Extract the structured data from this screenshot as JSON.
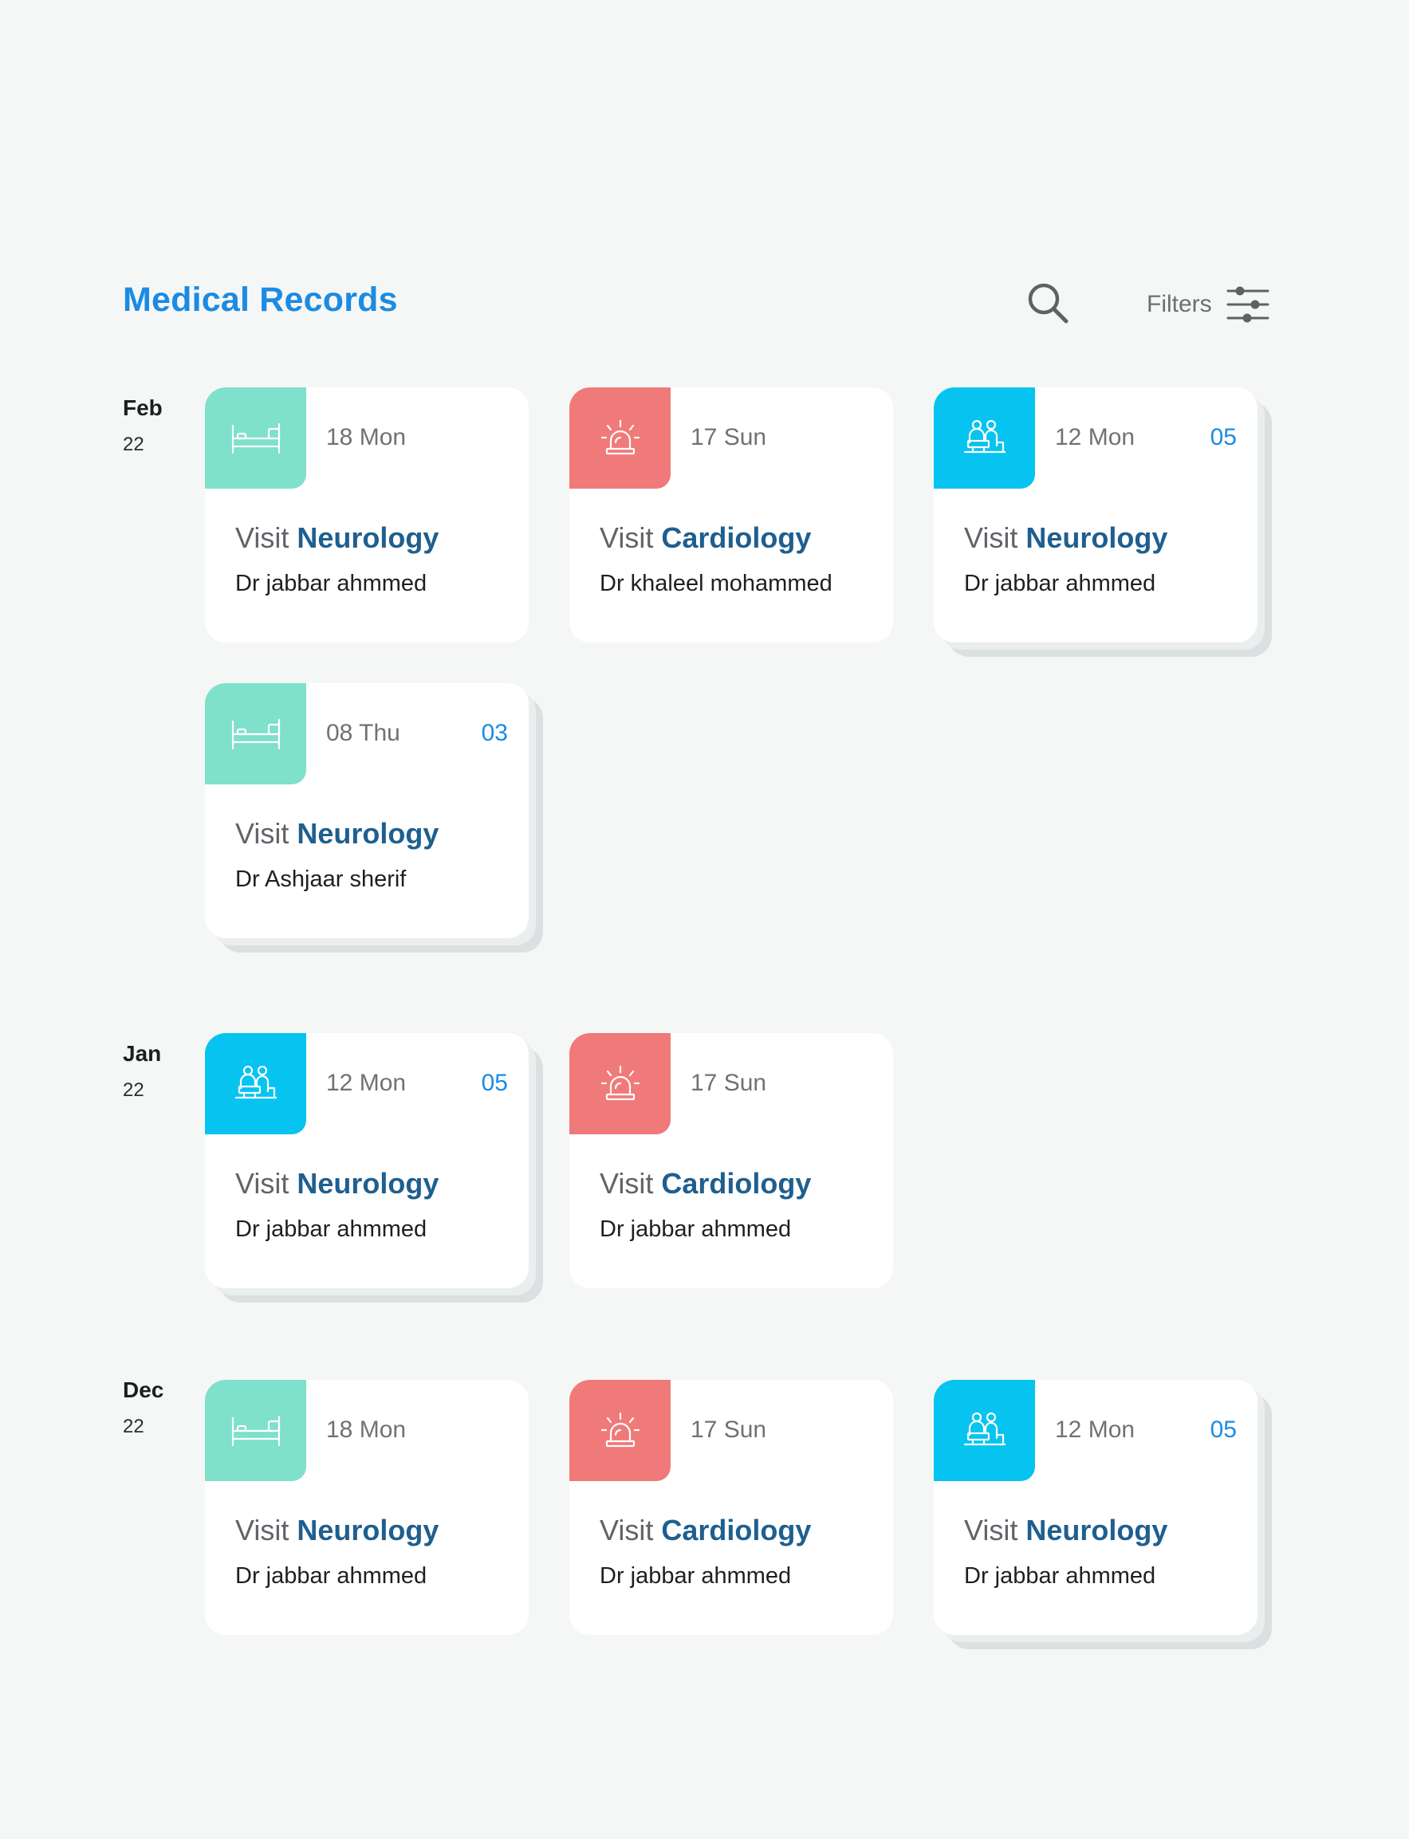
{
  "header": {
    "title": "Medical Records",
    "filters_label": "Filters",
    "search_icon": "search-icon",
    "filters_icon": "sliders-icon"
  },
  "colors": {
    "accent": "#1b8be3",
    "department": "#1f5f8f",
    "inpatient": "#7fe0cb",
    "emergency": "#f07a79",
    "consultation": "#06c4ef"
  },
  "groups": [
    {
      "month": "Feb",
      "year": "22",
      "cards": [
        {
          "type": "inpatient",
          "icon": "hospital-bed-icon",
          "date": "18 Mon",
          "count": "",
          "prefix": "Visit",
          "department": "Neurology",
          "doctor": "Dr jabbar ahmmed"
        },
        {
          "type": "emergency",
          "icon": "siren-icon",
          "date": "17 Sun",
          "count": "",
          "prefix": "Visit",
          "department": "Cardiology",
          "doctor": "Dr khaleel mohammed"
        },
        {
          "type": "consultation",
          "icon": "doctor-consultation-icon",
          "date": "12 Mon",
          "count": "05",
          "prefix": "Visit",
          "department": "Neurology",
          "doctor": "Dr jabbar ahmmed"
        },
        {
          "type": "inpatient",
          "icon": "hospital-bed-icon",
          "date": "08 Thu",
          "count": "03",
          "prefix": "Visit",
          "department": "Neurology",
          "doctor": "Dr Ashjaar sherif"
        }
      ]
    },
    {
      "month": "Jan",
      "year": "22",
      "cards": [
        {
          "type": "consultation",
          "icon": "doctor-consultation-icon",
          "date": "12 Mon",
          "count": "05",
          "prefix": "Visit",
          "department": "Neurology",
          "doctor": "Dr jabbar ahmmed"
        },
        {
          "type": "emergency",
          "icon": "siren-icon",
          "date": "17 Sun",
          "count": "",
          "prefix": "Visit",
          "department": "Cardiology",
          "doctor": "Dr jabbar ahmmed"
        }
      ]
    },
    {
      "month": "Dec",
      "year": "22",
      "cards": [
        {
          "type": "inpatient",
          "icon": "hospital-bed-icon",
          "date": "18 Mon",
          "count": "",
          "prefix": "Visit",
          "department": "Neurology",
          "doctor": "Dr jabbar ahmmed"
        },
        {
          "type": "emergency",
          "icon": "siren-icon",
          "date": "17 Sun",
          "count": "",
          "prefix": "Visit",
          "department": "Cardiology",
          "doctor": "Dr jabbar ahmmed"
        },
        {
          "type": "consultation",
          "icon": "doctor-consultation-icon",
          "date": "12 Mon",
          "count": "05",
          "prefix": "Visit",
          "department": "Neurology",
          "doctor": "Dr jabbar ahmmed"
        }
      ]
    }
  ]
}
